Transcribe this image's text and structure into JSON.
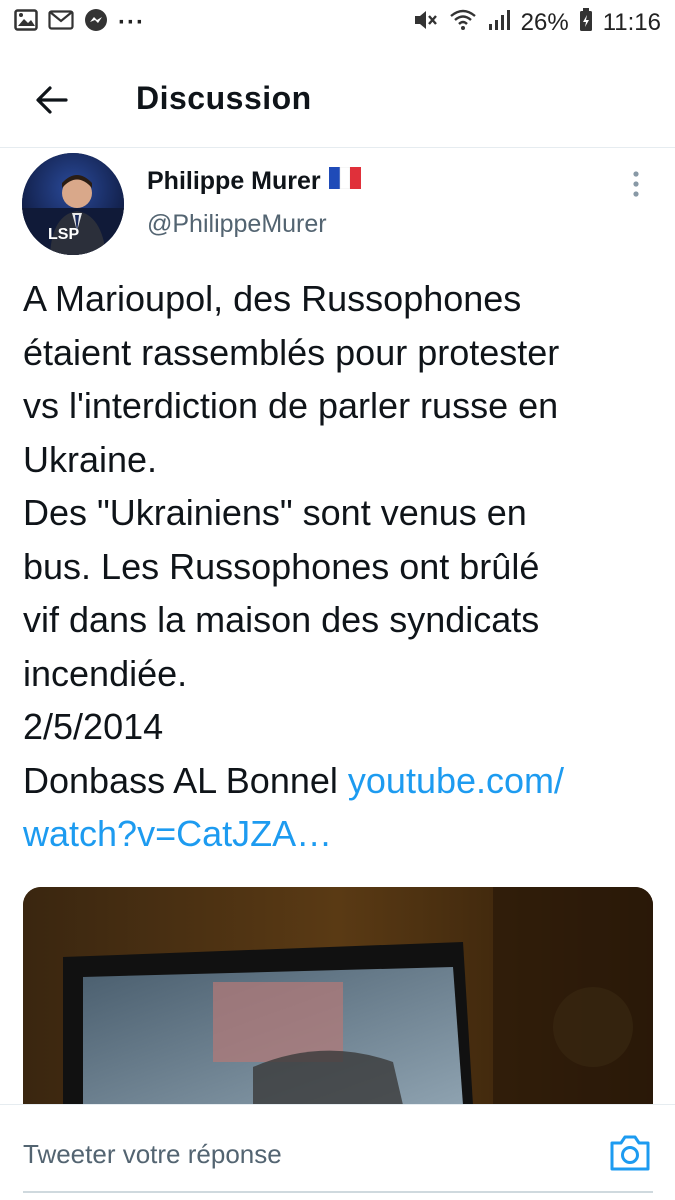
{
  "status_bar": {
    "notification_icons": [
      "gallery-icon",
      "mail-icon",
      "messenger-icon"
    ],
    "more": "···",
    "battery": "26%",
    "time": "11:16"
  },
  "header": {
    "title": "Discussion"
  },
  "tweet": {
    "author_name": "Philippe Murer",
    "author_flag": "🇫🇷",
    "author_handle": "@PhilippeMurer",
    "avatar_logo": "LSP",
    "body_lines": [
      "A Marioupol, des Russophones",
      "étaient rassemblés pour protester",
      "vs l'interdiction de parler russe en",
      "Ukraine.",
      "Des \"Ukrainiens\" sont venus en",
      "bus. Les Russophones ont brûlé",
      "vif dans la maison des syndicats",
      "incendiée.",
      "2/5/2014"
    ],
    "last_line_text": "Donbass AL Bonnel ",
    "link_part1": "youtube.com/",
    "link_part2": "watch?v=CatJZA…"
  },
  "reply": {
    "placeholder": "Tweeter votre réponse"
  },
  "colors": {
    "link": "#1d9bf0",
    "muted": "#536471",
    "text": "#0f1419"
  }
}
